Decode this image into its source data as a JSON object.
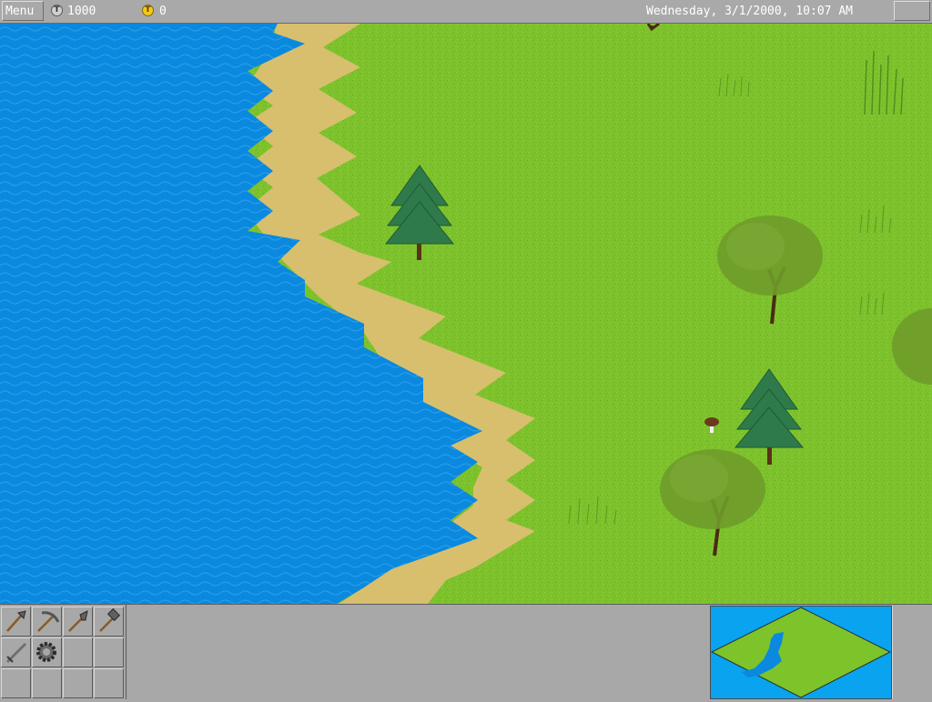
{
  "topbar": {
    "menu_label": "Menu",
    "money_icon": "T",
    "money_value": "1000",
    "gold_icon": "T",
    "gold_value": "0",
    "datetime": "Wednesday, 3/1/2000, 10:07 AM"
  },
  "colors": {
    "water": "#0a8ae0",
    "sand": "#d8c070",
    "grass": "#7cc42a",
    "panel": "#a8a8a8",
    "gold_coin": "#f2c81e"
  },
  "world": {
    "objects": [
      {
        "name": "pine-tree"
      },
      {
        "name": "pine-tree"
      },
      {
        "name": "leafy-tree"
      },
      {
        "name": "leafy-tree"
      },
      {
        "name": "leafy-tree"
      },
      {
        "name": "mushroom"
      },
      {
        "name": "tall-grass"
      },
      {
        "name": "tall-grass"
      },
      {
        "name": "tall-grass"
      },
      {
        "name": "tall-grass"
      },
      {
        "name": "tall-grass"
      }
    ]
  },
  "toolbar": {
    "tools": [
      {
        "name": "axe-icon"
      },
      {
        "name": "pickaxe-icon"
      },
      {
        "name": "shovel-icon"
      },
      {
        "name": "hammer-icon"
      },
      {
        "name": "sword-icon"
      },
      {
        "name": "gear-icon"
      }
    ]
  }
}
